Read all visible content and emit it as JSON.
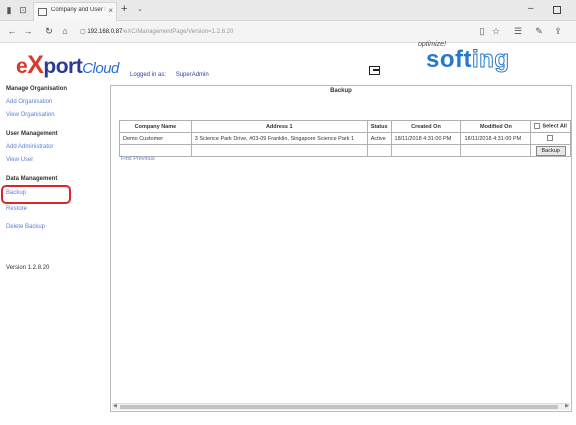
{
  "browser": {
    "tab_title": "Company and User Ma",
    "tab_close": "×",
    "new_tab": "+",
    "tab_menu": "⌄",
    "url_host": "192.168.0.87",
    "url_path": "/eXC/ManagementPage/Version=1.2.8.20",
    "icons": [
      "back-icon",
      "forward-icon",
      "refresh-icon",
      "home-icon",
      "lock-icon",
      "reading-view-icon",
      "favorite-icon",
      "favorites-list-icon",
      "pen-icon",
      "share-icon"
    ]
  },
  "header": {
    "logo_e": "e",
    "logo_x": "X",
    "logo_port": "port",
    "logo_cloud": "Cloud",
    "logged_in_as": "Logged in as:",
    "username": "SuperAdmin",
    "brand_top": "optimize!",
    "brand_soft": "soft",
    "brand_ing": "ing"
  },
  "sidebar": {
    "manage_org_title": "Manage Organisation",
    "add_org": "Add Organisation",
    "view_org": "View Organisation",
    "user_mgmt_title": "User Management",
    "add_admin": "Add Administrator",
    "view_user": "View User",
    "data_mgmt_title": "Data Management",
    "backup": "Backup",
    "restore": "Restore",
    "delete_backup": "Delete Backup",
    "version": "Version 1.2.8.20"
  },
  "main": {
    "panel_title": "Backup",
    "columns": [
      "Company Name",
      "Address 1",
      "Status",
      "Created On",
      "Modified On",
      "Select All"
    ],
    "rows": [
      {
        "company": "Demo Customer",
        "address": "3 Science Park Drive, #03-09 Franklin, Singapore Science Park 1",
        "status": "Active",
        "created": "18/11/2018 4:31:00 PM",
        "modified": "18/11/2018 4:31:00 PM"
      }
    ],
    "backup_button": "Backup",
    "pager": "First Previous"
  },
  "colors": {
    "accent_red": "#d8262b",
    "link_blue": "#5c7fd4",
    "brand_blue": "#2579c9",
    "logo_navy": "#2b3b8f"
  }
}
